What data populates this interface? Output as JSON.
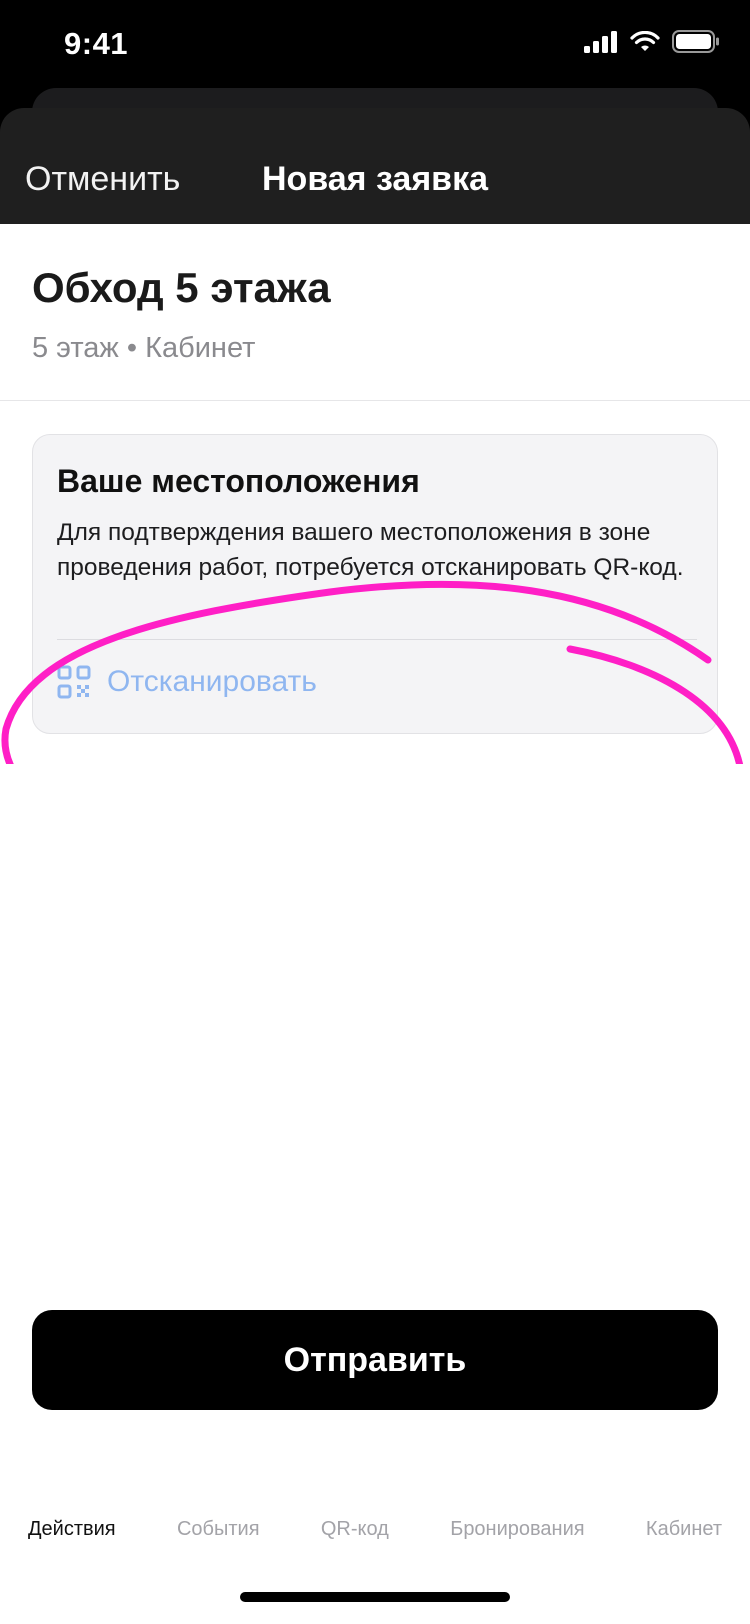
{
  "status_bar": {
    "time": "9:41",
    "icons": [
      "cellular-signal-icon",
      "wifi-icon",
      "battery-icon"
    ]
  },
  "nav": {
    "cancel_label": "Отменить",
    "title": "Новая заявка"
  },
  "task": {
    "title": "Обход 5 этажа",
    "subtitle": "5 этаж • Кабинет"
  },
  "location_card": {
    "title": "Ваше местоположения",
    "text": "Для подтверждения вашего местоположения в зоне проведения работ, потребуется отсканировать QR-код.",
    "scan_icon": "qr-code-icon",
    "scan_label": "Отсканировать"
  },
  "annotation": {
    "color": "#ff1fc6"
  },
  "submit": {
    "label": "Отправить"
  },
  "tabs": [
    {
      "label": "Действия",
      "active": true
    },
    {
      "label": "События",
      "active": false
    },
    {
      "label": "QR-код",
      "active": false
    },
    {
      "label": "Бронирования",
      "active": false
    },
    {
      "label": "Кабинет",
      "active": false
    }
  ],
  "colors": {
    "accent_link": "#8fb6f0",
    "nav_background": "#1f1f1f",
    "card_background": "#f4f4f6"
  }
}
